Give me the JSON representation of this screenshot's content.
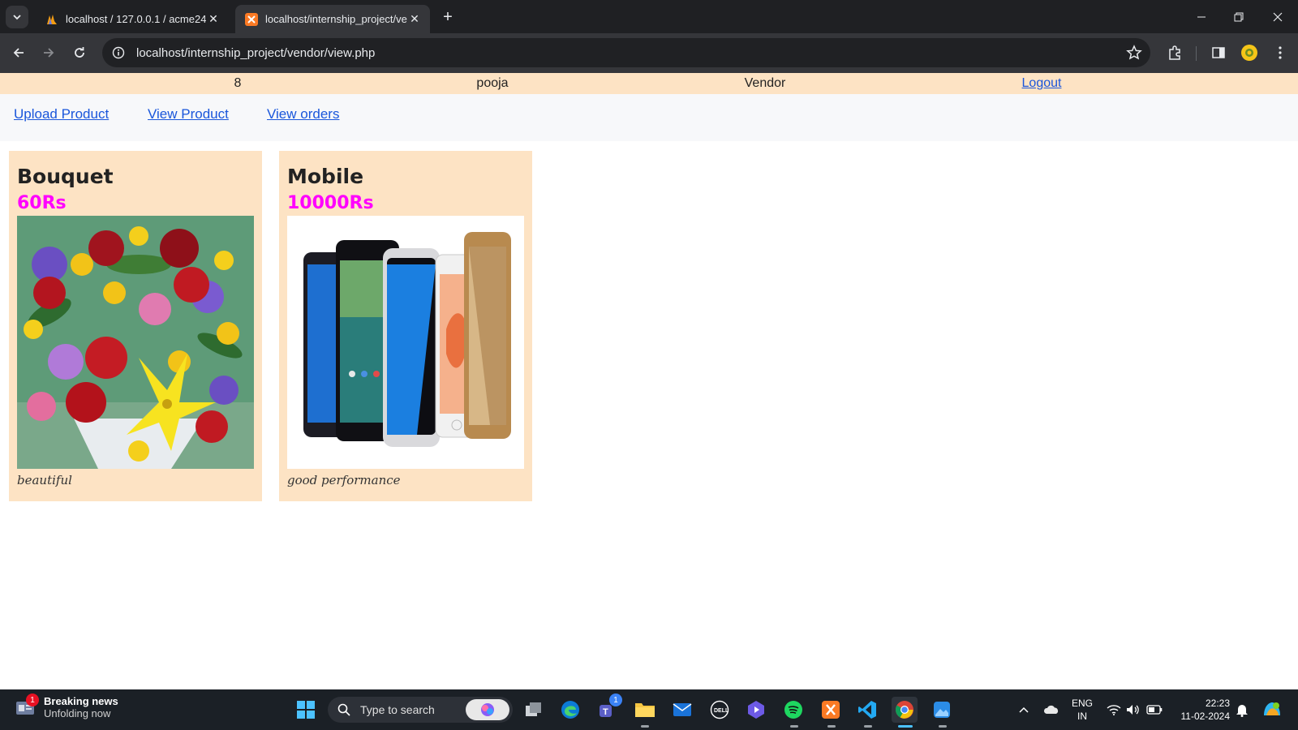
{
  "browser": {
    "tabs": [
      {
        "title": "localhost / 127.0.0.1 / acme24 /",
        "active": false
      },
      {
        "title": "localhost/internship_project/vendor/view.php",
        "active": true
      }
    ],
    "url": "localhost/internship_project/vendor/view.php"
  },
  "userbar": {
    "id": "8",
    "name": "pooja",
    "role": "Vendor",
    "logout": "Logout"
  },
  "menu": {
    "upload": "Upload Product",
    "view": "View Product",
    "orders": "View orders"
  },
  "products": [
    {
      "name": "Bouquet",
      "price": "60Rs",
      "description": "beautiful",
      "image": "flower-bouquet"
    },
    {
      "name": "Mobile",
      "price": "10000Rs",
      "description": "good performance",
      "image": "smartphones"
    }
  ],
  "taskbar": {
    "news_title": "Breaking news",
    "news_sub": "Unfolding now",
    "news_badge": "1",
    "search_placeholder": "Type to search",
    "teams_badge": "1",
    "lang": "ENG",
    "region": "IN",
    "time": "22:23",
    "date": "11-02-2024"
  },
  "colors": {
    "userbar_bg": "#fde3c4",
    "card_bg": "#fde3c4",
    "price": "#ff00ff",
    "link": "#1a56db"
  }
}
